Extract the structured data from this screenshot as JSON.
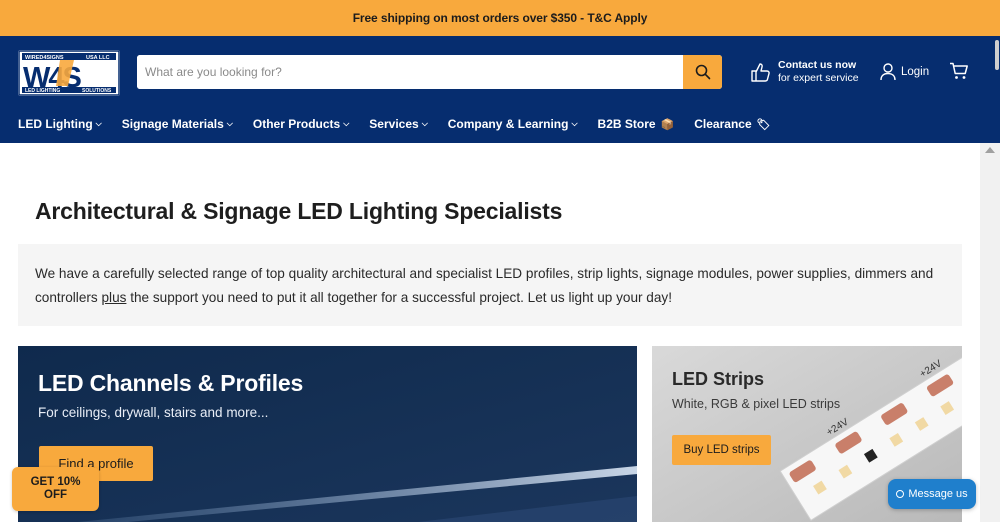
{
  "announcement": "Free shipping on most orders over $350 - T&C Apply",
  "logo": {
    "brand_top_left": "WIRED4SIGNS",
    "brand_top_right": "USA LLC",
    "brand_bottom_left": "LED LIGHTING",
    "brand_bottom_right": "SOLUTIONS",
    "mark": "W4S"
  },
  "search": {
    "placeholder": "What are you looking for?",
    "value": ""
  },
  "contact": {
    "line1": "Contact us now",
    "line2": "for expert service"
  },
  "account": {
    "login_label": "Login"
  },
  "nav": [
    {
      "label": "LED Lighting",
      "dropdown": true
    },
    {
      "label": "Signage Materials",
      "dropdown": true
    },
    {
      "label": "Other Products",
      "dropdown": true
    },
    {
      "label": "Services",
      "dropdown": true
    },
    {
      "label": "Company & Learning",
      "dropdown": true
    },
    {
      "label": "B2B Store",
      "emoji": "📦"
    },
    {
      "label": "Clearance",
      "emoji": "🏷"
    }
  ],
  "main": {
    "title": "Architectural & Signage LED Lighting Specialists",
    "intro_part1": "We have a carefully selected range of top quality architectural and specialist LED profiles, strip lights, signage modules, power supplies, dimmers and controllers ",
    "intro_link": "plus",
    "intro_part2": " the support you need to put it all together for a successful project. Let us light up your day!"
  },
  "cards": [
    {
      "title": "LED Channels & Profiles",
      "subtitle": "For ceilings, drywall, stairs and more...",
      "button": "Find a profile"
    },
    {
      "title": "LED Strips",
      "subtitle": "White, RGB & pixel LED strips",
      "button": "Buy LED strips",
      "strip_label": "+24V"
    }
  ],
  "promo": {
    "line1": "GET 10%",
    "line2": "OFF"
  },
  "chat": {
    "label": "Message us"
  },
  "colors": {
    "accent": "#f8a93d",
    "header_bg": "#062d6f",
    "chat": "#1f7fcc"
  }
}
